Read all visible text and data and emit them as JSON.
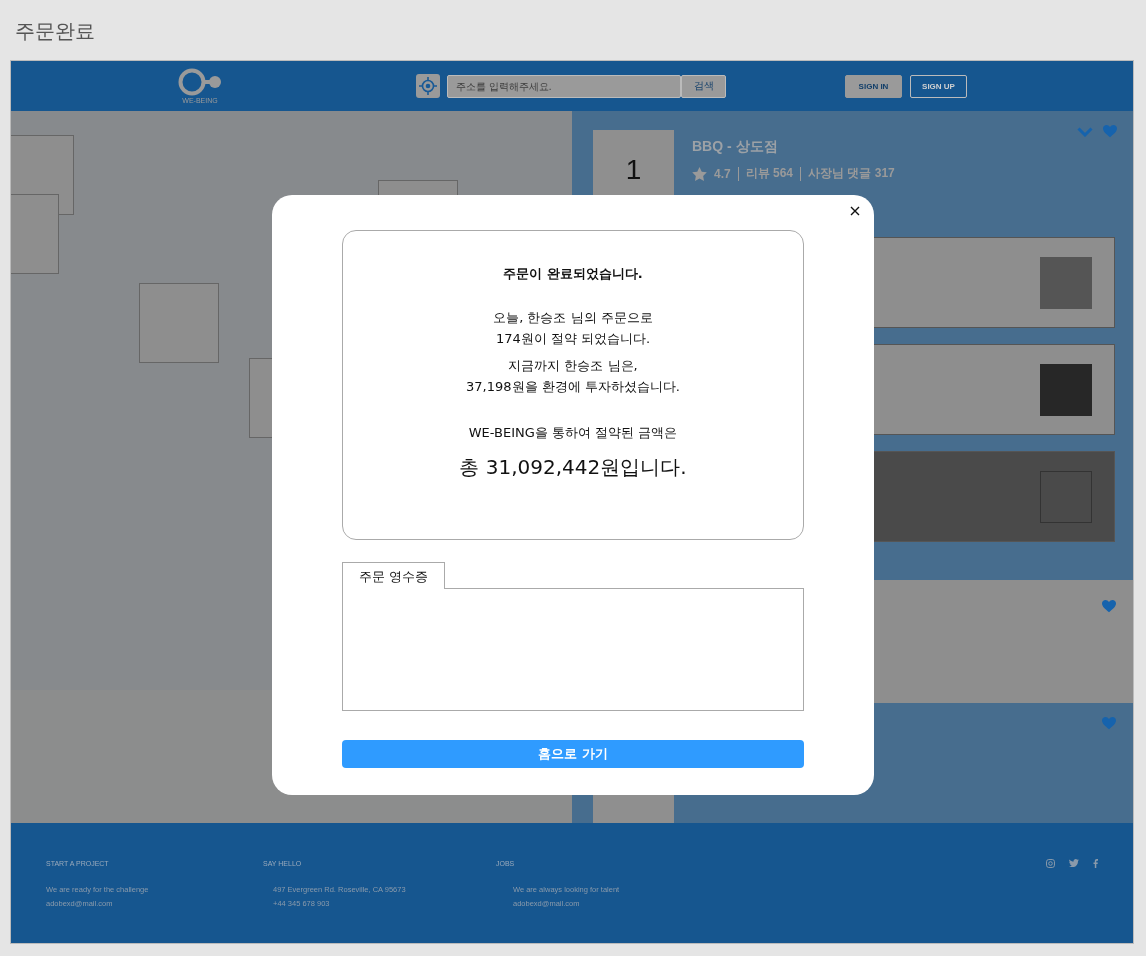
{
  "page_title": "주문완료",
  "header": {
    "logo_text": "WE-BEING",
    "search": {
      "placeholder": "주소를 입력해주세요.",
      "button": "검색"
    },
    "buttons": [
      {
        "label": "SIGN IN",
        "kind": "filled"
      },
      {
        "label": "SIGN UP",
        "kind": "outline"
      }
    ]
  },
  "store": {
    "rank": "1",
    "name": "BBQ - 상도점",
    "rating": "4.7",
    "reviews": "리뷰 564",
    "replies": "사장님 댓글 317",
    "menu_items": [
      {
        "kind": "light"
      },
      {
        "kind": "dark-thumb"
      },
      {
        "kind": "dark"
      }
    ]
  },
  "modal": {
    "title": "주문이 완료되었습니다.",
    "paragraphs": [
      [
        "오늘, 한승조 님의 주문으로",
        "174원이 절약 되었습니다."
      ],
      [
        "지금까지 한승조 님은,",
        "37,198원을 환경에 투자하셨습니다."
      ]
    ],
    "total_intro": "WE-BEING을 통하여 절약된 금액은",
    "total": "총 31,092,442원입니다.",
    "receipt_tab": "주문 영수증",
    "home_button": "홈으로 가기"
  },
  "footer": {
    "columns": [
      {
        "heading": "START A PROJECT",
        "lines": [
          "We are ready for the challenge",
          "adobexd@mail.com"
        ]
      },
      {
        "heading": "SAY HELLO",
        "lines": [
          "497 Evergreen Rd. Roseville, CA 95673",
          "+44 345 678 903"
        ]
      },
      {
        "heading": "JOBS",
        "lines": [
          "We are always looking for talent",
          "adobexd@mail.com"
        ]
      }
    ]
  }
}
